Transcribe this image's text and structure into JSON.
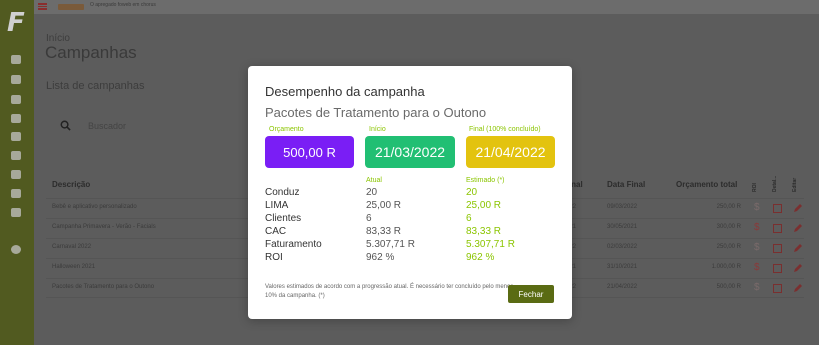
{
  "app": {
    "logo": "F",
    "topbar_text": "O apregado foweb em chorus",
    "breadcrumb": "Início",
    "page_title": "Campanhas",
    "section_title": "Lista de campanhas",
    "search_placeholder": "Buscador"
  },
  "sidebar": {
    "icons": [
      "briefcase-icon",
      "calendar-icon",
      "calendar-check-icon",
      "thumbs-up-icon",
      "bar-chart-icon",
      "grid-icon",
      "user-icon",
      "money-icon",
      "graduation-cap-icon",
      "gear-icon"
    ]
  },
  "table": {
    "headers": {
      "description": "Descrição",
      "final_short": "Final",
      "end_date": "Data Final",
      "total_budget": "Orçamento total",
      "roi": "ROI",
      "details": "Detal...",
      "edit": "Editar"
    },
    "rows": [
      {
        "description": "Bebê e aplicativo personalizado",
        "final": "022",
        "end_date": "09/03/2022",
        "total": "250,00 R"
      },
      {
        "description": "Campanha Primavera - Verão - Facials",
        "final": "021",
        "end_date": "30/05/2021",
        "total": "300,00 R"
      },
      {
        "description": "Carnaval 2022",
        "final": "022",
        "end_date": "02/03/2022",
        "total": "250,00 R"
      },
      {
        "description": "Halloween 2021",
        "final": "021",
        "end_date": "31/10/2021",
        "total": "1.000,00 R"
      },
      {
        "description": "Pacotes de Tratamento para o Outono",
        "final": "022",
        "end_date": "21/04/2022",
        "total": "500,00 R"
      }
    ]
  },
  "modal": {
    "title": "Desempenho da campanha",
    "subtitle": "Pacotes de Tratamento para o Outono",
    "budget_label": "Orçamento",
    "budget_value": "500,00 R",
    "start_label": "Início",
    "start_value": "21/03/2022",
    "end_label": "Final (100% concluído)",
    "end_value": "21/04/2022",
    "current_header": "Atual",
    "estimated_header": "Estimado (*)",
    "metrics": [
      {
        "label": "Conduz",
        "current": "20",
        "estimated": "20"
      },
      {
        "label": "LIMA",
        "current": "25,00 R",
        "estimated": "25,00 R"
      },
      {
        "label": "Clientes",
        "current": "6",
        "estimated": "6"
      },
      {
        "label": "CAC",
        "current": "83,33 R",
        "estimated": "83,33 R"
      },
      {
        "label": "Faturamento",
        "current": "5.307,71 R",
        "estimated": "5.307,71 R"
      },
      {
        "label": "ROI",
        "current": "962 %",
        "estimated": "962 %"
      }
    ],
    "note": "Valores estimados de acordo com a progressão atual. É necessário ter concluído pelo menos 10% da campanha. (*)",
    "close_label": "Fechar"
  },
  "colors": {
    "sidebar": "#515a20",
    "budget_box": "#7a1ef5",
    "start_box": "#21bf73",
    "end_box": "#e3c30f",
    "accent_green": "#8bc500",
    "close_button": "#5a6b13"
  }
}
